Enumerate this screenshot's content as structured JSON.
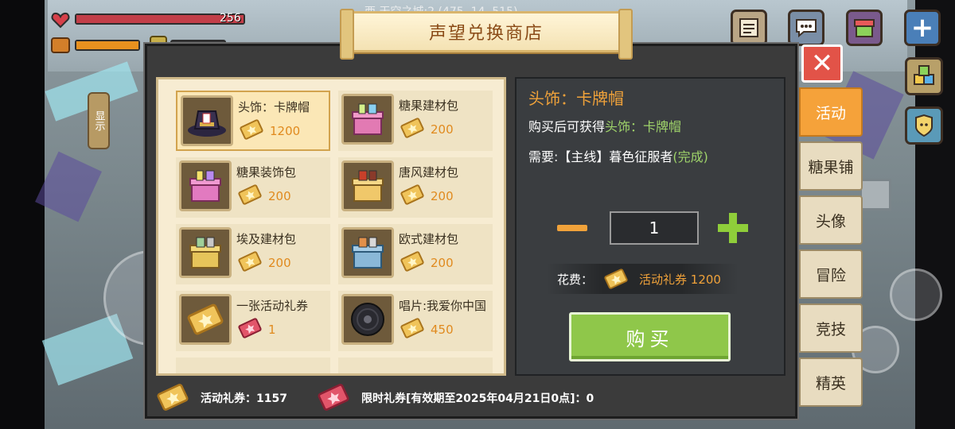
{
  "hud": {
    "hp_value": "256",
    "location": "西 天空之城:2 (475, 14, 515)"
  },
  "dialog": {
    "title": "声望兑换商店",
    "close_label": "✕"
  },
  "side_button": {
    "label": "显示"
  },
  "items": [
    {
      "name": "头饰：卡牌帽",
      "price": "1200",
      "currency": "活动礼券",
      "icon": "card-hat-icon"
    },
    {
      "name": "糖果建材包",
      "price": "200",
      "currency": "活动礼券",
      "icon": "gift-box-icon"
    },
    {
      "name": "糖果装饰包",
      "price": "200",
      "currency": "活动礼券",
      "icon": "gift-box-icon"
    },
    {
      "name": "唐风建材包",
      "price": "200",
      "currency": "活动礼券",
      "icon": "gift-box-icon"
    },
    {
      "name": "埃及建材包",
      "price": "200",
      "currency": "活动礼券",
      "icon": "gift-box-icon"
    },
    {
      "name": "欧式建材包",
      "price": "200",
      "currency": "活动礼券",
      "icon": "gift-box-icon"
    },
    {
      "name": "一张活动礼券",
      "price": "1",
      "currency": "限时礼券",
      "icon": "ticket-icon"
    },
    {
      "name": "唱片:我爱你中国",
      "price": "450",
      "currency": "活动礼券",
      "icon": "record-icon"
    }
  ],
  "detail": {
    "title": "头饰：卡牌帽",
    "line1_prefix": "购买后可获得",
    "line1_item": "头饰：卡牌帽",
    "line2_prefix": "需要:【主线】暮色征服者",
    "line2_status": "(完成)",
    "quantity": "1",
    "cost_label": "花费：",
    "cost_value": "活动礼券 1200",
    "buy_label": "购买"
  },
  "bottom": {
    "event_ticket": "活动礼券：1157",
    "limited_ticket": "限时礼券[有效期至2025年04月21日0点]：0"
  },
  "tabs": [
    {
      "label": "活动",
      "active": true
    },
    {
      "label": "糖果铺",
      "active": false
    },
    {
      "label": "头像",
      "active": false
    },
    {
      "label": "冒险",
      "active": false
    },
    {
      "label": "竞技",
      "active": false
    },
    {
      "label": "精英",
      "active": false
    }
  ],
  "colors": {
    "accent_orange": "#f0a23a",
    "buy_green": "#8fc74a",
    "close_red": "#e25348",
    "status_green": "#9fd36a"
  }
}
